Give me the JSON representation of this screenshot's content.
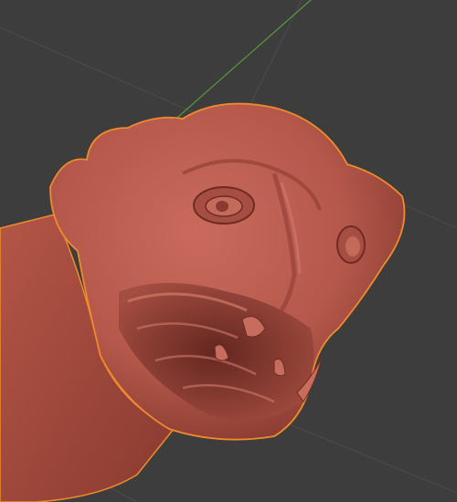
{
  "viewport": {
    "background": "#3d3d3d",
    "grid_line_color": "#4a4a4a",
    "y_axis_color": "#5d9a3a",
    "mesh_color": "#b5584b",
    "mesh_shadow_color": "#7a3128",
    "selection_outline_color": "#f08b2c",
    "object": "sculpted-creature-head-mesh"
  }
}
